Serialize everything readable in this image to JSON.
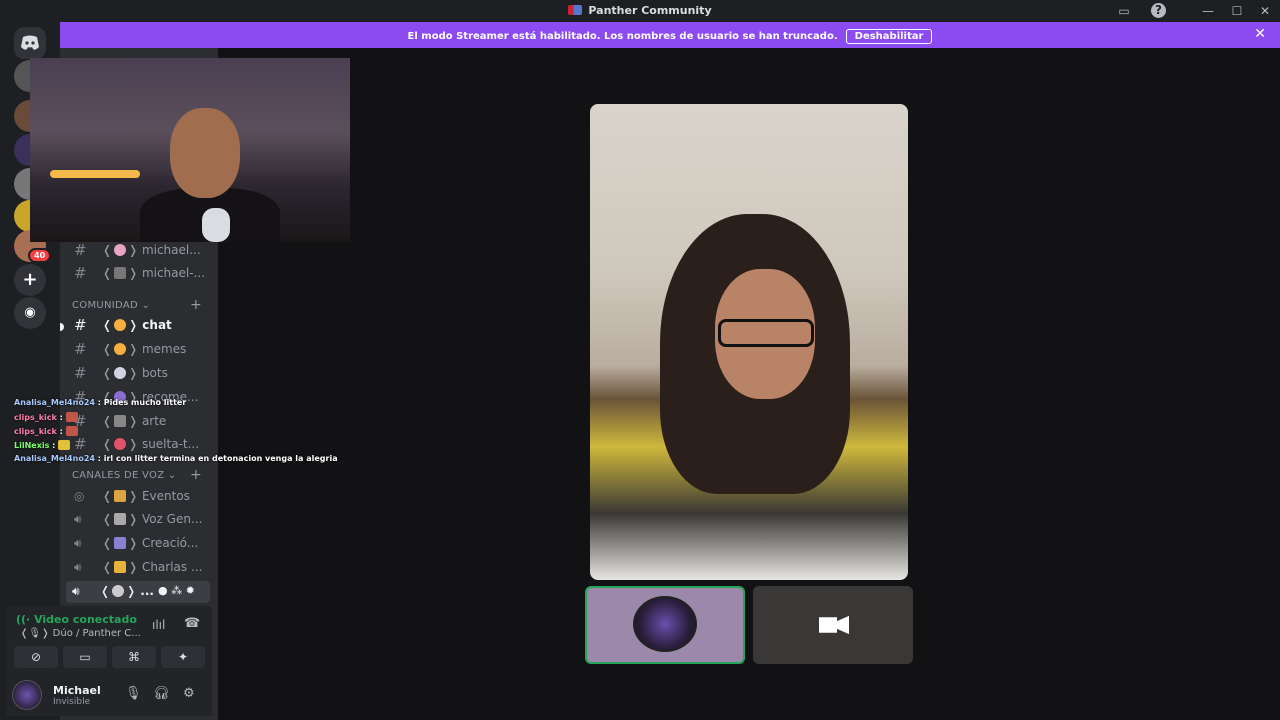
{
  "window": {
    "title": "Panther Community"
  },
  "banner": {
    "text": "El modo Streamer está habilitado. Los nombres de usuario se han truncado.",
    "button_label": "Deshabilitar"
  },
  "rail": {
    "badge_count": "40"
  },
  "sidebar": {
    "channels_top": [
      {
        "label": "michael..."
      },
      {
        "label": "michael-..."
      }
    ],
    "community": {
      "title": "COMUNIDAD",
      "channels": [
        {
          "label": "chat",
          "active": true
        },
        {
          "label": "memes"
        },
        {
          "label": "bots"
        },
        {
          "label": "recome..."
        },
        {
          "label": "arte"
        },
        {
          "label": "suelta-t..."
        }
      ]
    },
    "voice": {
      "title": "CANALES DE VOZ",
      "channels": [
        {
          "label": "Eventos"
        },
        {
          "label": "Voz Gen..."
        },
        {
          "label": "Creació..."
        },
        {
          "label": "Charlas ..."
        },
        {
          "label": "..."
        }
      ]
    }
  },
  "voice_panel": {
    "status": "Video conectado",
    "channel": "Dúo / Panther C..."
  },
  "user": {
    "name": "Michael",
    "status": "Invisible"
  },
  "chat_overlay": [
    {
      "user": "Analisa_Mel4no24",
      "message": "Pides mucho litter",
      "user_color": "#a9c8ff"
    },
    {
      "user": "clips_kick",
      "message": "",
      "user_color": "#ff7fa8",
      "emote": true
    },
    {
      "user": "clips_kick",
      "message": "",
      "user_color": "#ff7fa8",
      "emote": true
    },
    {
      "user": "LilNexis",
      "message": "",
      "user_color": "#7dff6b",
      "emote": true
    },
    {
      "user": "Analisa_Mel4no24",
      "message": "irl con litter termina en detonacion venga la alegria",
      "user_color": "#a9c8ff"
    }
  ],
  "colors": {
    "accent": "#8c4bf0",
    "connected": "#23a55a",
    "badge": "#f23f43"
  }
}
